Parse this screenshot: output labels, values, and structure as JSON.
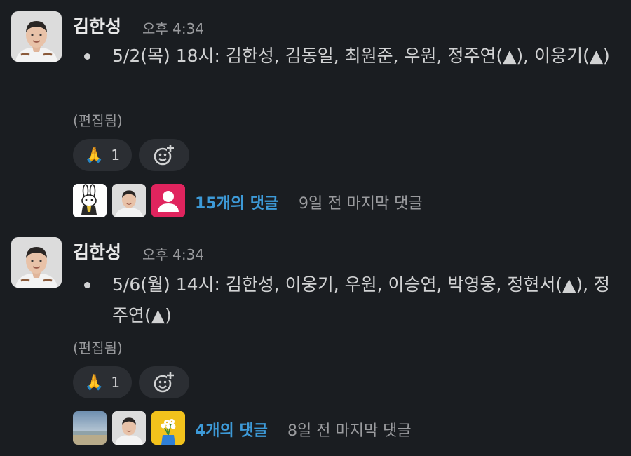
{
  "messages": [
    {
      "author": "김한성",
      "time": "오후 4:34",
      "text": "5/2(목) 18시: 김한성, 김동일, 최원준, 우원, 정주연(▲), 이웅기(▲)",
      "edited": "(편집됨)",
      "reaction": {
        "emoji": "🙏",
        "count": "1",
        "icon": "folded-hands-icon"
      },
      "add_reaction_icon": "add-emoji-icon",
      "thread": {
        "avatars": [
          "rabbit-cartoon-avatar",
          "man-photo-avatar",
          "default-pink-avatar"
        ],
        "count_label": "15개의 댓글",
        "last_reply": "9일 전 마지막 댓글"
      }
    },
    {
      "author": "김한성",
      "time": "오후 4:34",
      "text": "5/6(월) 14시: 김한성, 이웅기, 우원, 이승연, 박영웅, 정현서(▲), 정주연(▲)",
      "edited": "(편집됨)",
      "reaction": {
        "emoji": "🙏",
        "count": "1",
        "icon": "folded-hands-icon"
      },
      "add_reaction_icon": "add-emoji-icon",
      "thread": {
        "avatars": [
          "beach-photo-avatar",
          "man-photo-avatar",
          "flowers-avatar"
        ],
        "count_label": "4개의 댓글",
        "last_reply": "8일 전 마지막 댓글"
      }
    }
  ],
  "colors": {
    "background": "#1a1d21",
    "link": "#3d9ad8",
    "muted": "#9a9b9e",
    "pill": "#2b2e33",
    "text": "#d1d2d3",
    "pink_avatar": "#e0245e"
  }
}
